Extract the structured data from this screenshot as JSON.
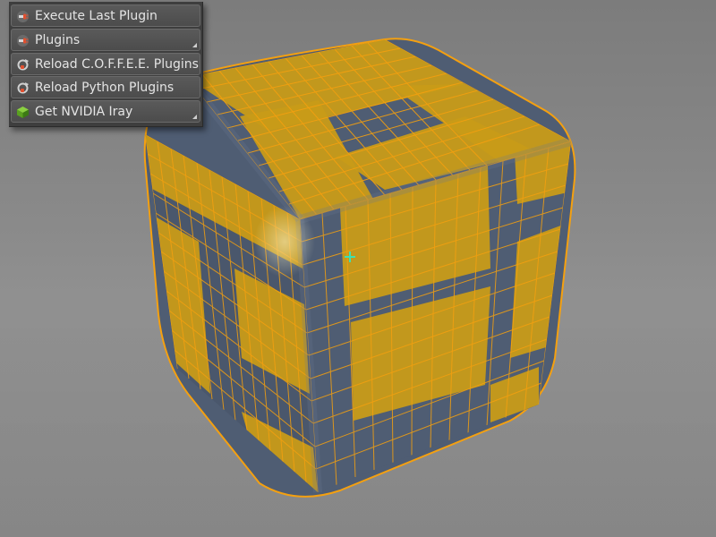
{
  "plugin_menu": {
    "items": [
      {
        "label": "Execute Last Plugin",
        "icon": "plug-icon"
      },
      {
        "label": "Plugins",
        "icon": "plug-icon"
      },
      {
        "label": "Reload C.O.F.F.E.E. Plugins",
        "icon": "reload-icon"
      },
      {
        "label": "Reload Python Plugins",
        "icon": "reload-icon"
      },
      {
        "label": "Get NVIDIA Iray",
        "icon": "nvidia-cube-icon"
      }
    ]
  },
  "viewport": {
    "background": "#8a8a8a",
    "object": "subdivided-cube",
    "selection_color": "#f4a010",
    "wire_color": "#5f8fcf",
    "cursor_color": "#3ee0b0"
  }
}
